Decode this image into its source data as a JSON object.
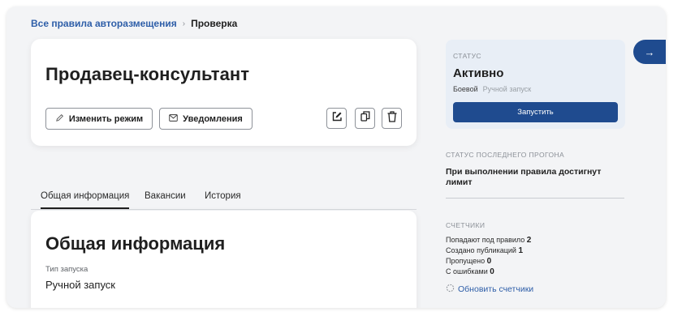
{
  "breadcrumb": {
    "parent": "Все правила авторазмещения",
    "separator": "›",
    "current": "Проверка"
  },
  "header": {
    "title": "Продавец-консультант",
    "change_mode_label": "Изменить режим",
    "notifications_label": "Уведомления",
    "icons": [
      "edit-icon",
      "copy-icon",
      "trash-icon"
    ]
  },
  "tabs": [
    {
      "label": "Общая информация",
      "active": true
    },
    {
      "label": "Вакансии",
      "active": false
    },
    {
      "label": "История",
      "active": false
    }
  ],
  "general": {
    "title": "Общая информация",
    "launch_type_label": "Тип запуска",
    "launch_type_value": "Ручной запуск"
  },
  "status": {
    "label": "Статус",
    "value": "Активно",
    "mode": "Боевой",
    "launch": "Ручной запуск",
    "run_button": "Запустить"
  },
  "side_tab": {
    "icon": "arrow-right-icon",
    "glyph": "→"
  },
  "last_run": {
    "label": "Статус последнего прогона",
    "text": "При выполнении правила достигнут лимит"
  },
  "counters": {
    "label": "Счетчики",
    "items": [
      {
        "label": "Попадают под правило",
        "value": "2"
      },
      {
        "label": "Создано публикаций",
        "value": "1"
      },
      {
        "label": "Пропущено",
        "value": "0"
      },
      {
        "label": "С ошибками",
        "value": "0"
      }
    ],
    "refresh_label": "Обновить счетчики"
  },
  "colors": {
    "accent": "#1f4b8f",
    "link": "#2e5ea8",
    "status_bg": "#e8eef6"
  }
}
